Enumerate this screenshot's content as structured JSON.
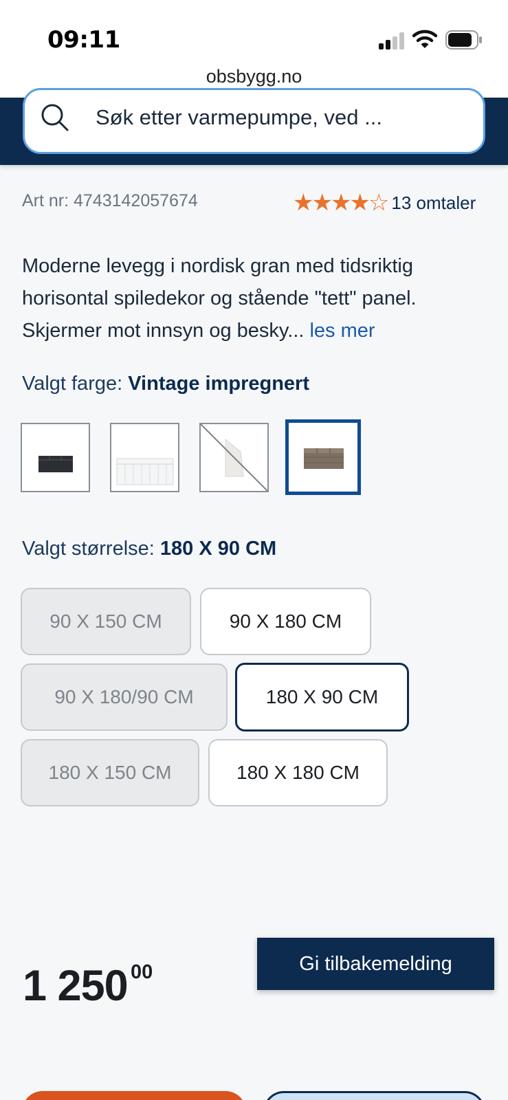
{
  "status_bar": {
    "time": "09:11",
    "url": "obsbygg.no"
  },
  "search": {
    "placeholder": "Søk etter varmepumpe, ved ..."
  },
  "product": {
    "art_nr": "Art nr: 4743142057674",
    "rating_stars": "★★★★☆",
    "rating_value": 4,
    "reviews_label": "13 omtaler",
    "description": "Moderne levegg i nordisk gran med tidsriktig horisontal spiledekor og stående \"tett\" panel. Skjermer mot innsyn og besky...",
    "read_more": "les mer"
  },
  "color": {
    "label": "Valgt farge:",
    "selected": "Vintage impregnert",
    "swatches": [
      {
        "name": "black",
        "color": "#2b2e33",
        "available": true
      },
      {
        "name": "white",
        "color": "#f2f2f2",
        "available": true
      },
      {
        "name": "white-unavailable",
        "color": "#eeeeee",
        "available": false
      },
      {
        "name": "vintage",
        "color": "#7d6f61",
        "available": true,
        "selected": true
      }
    ]
  },
  "size": {
    "label": "Valgt størrelse:",
    "selected": "180 X 90 CM",
    "options": [
      {
        "label": "90 X 150 CM",
        "state": "disabled"
      },
      {
        "label": "90 X 180 CM",
        "state": "available"
      },
      {
        "label": "90 X 180/90 CM",
        "state": "disabled"
      },
      {
        "label": "180 X 90 CM",
        "state": "selected"
      },
      {
        "label": "180 X 150 CM",
        "state": "disabled"
      },
      {
        "label": "180 X 180 CM",
        "state": "available"
      }
    ]
  },
  "price": {
    "whole": "1 250",
    "cents": "00"
  },
  "feedback": {
    "label": "Gi tilbakemelding"
  },
  "colors": {
    "brand_navy": "#0d2a4f",
    "accent_orange": "#d9541e",
    "link_blue": "#1e5aa8",
    "star_orange": "#e8732e"
  }
}
